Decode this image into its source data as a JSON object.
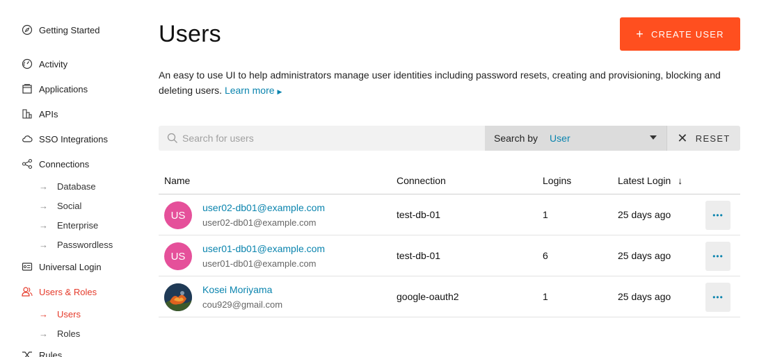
{
  "sidebar": {
    "items": [
      {
        "label": "Getting Started",
        "icon": "compass-icon"
      },
      {
        "label": "Activity",
        "icon": "gauge-icon"
      },
      {
        "label": "Applications",
        "icon": "applications-icon"
      },
      {
        "label": "APIs",
        "icon": "apis-icon"
      },
      {
        "label": "SSO Integrations",
        "icon": "cloud-icon"
      },
      {
        "label": "Connections",
        "icon": "connections-icon"
      },
      {
        "label": "Universal Login",
        "icon": "universal-login-icon"
      },
      {
        "label": "Users & Roles",
        "icon": "users-icon"
      },
      {
        "label": "Rules",
        "icon": "rules-icon"
      }
    ],
    "connections_sub": [
      "Database",
      "Social",
      "Enterprise",
      "Passwordless"
    ],
    "users_sub": [
      "Users",
      "Roles"
    ],
    "active_color": "#e53a2a"
  },
  "header": {
    "title": "Users",
    "create_button": "CREATE USER",
    "create_button_color": "#ff4f1f"
  },
  "description": {
    "text": "An easy to use UI to help administrators manage user identities including password resets, creating and provisioning, blocking and deleting users.",
    "link": "Learn more"
  },
  "search": {
    "placeholder": "Search for users",
    "search_by_label": "Search by",
    "search_by_value": "User",
    "reset_label": "RESET"
  },
  "table": {
    "columns": [
      "Name",
      "Connection",
      "Logins",
      "Latest Login"
    ],
    "sort_indicator": "↓",
    "rows": [
      {
        "initials": "US",
        "name": "user02-db01@example.com",
        "email": "user02-db01@example.com",
        "connection": "test-db-01",
        "logins": "1",
        "latest_login": "25 days ago",
        "avatar": "initials"
      },
      {
        "initials": "US",
        "name": "user01-db01@example.com",
        "email": "user01-db01@example.com",
        "connection": "test-db-01",
        "logins": "6",
        "latest_login": "25 days ago",
        "avatar": "initials"
      },
      {
        "initials": "",
        "name": "Kosei Moriyama",
        "email": "cou929@gmail.com",
        "connection": "google-oauth2",
        "logins": "1",
        "latest_login": "25 days ago",
        "avatar": "photo"
      }
    ],
    "more_label": "•••",
    "link_color": "#0a84ae",
    "avatar_color": "#e5509a"
  }
}
